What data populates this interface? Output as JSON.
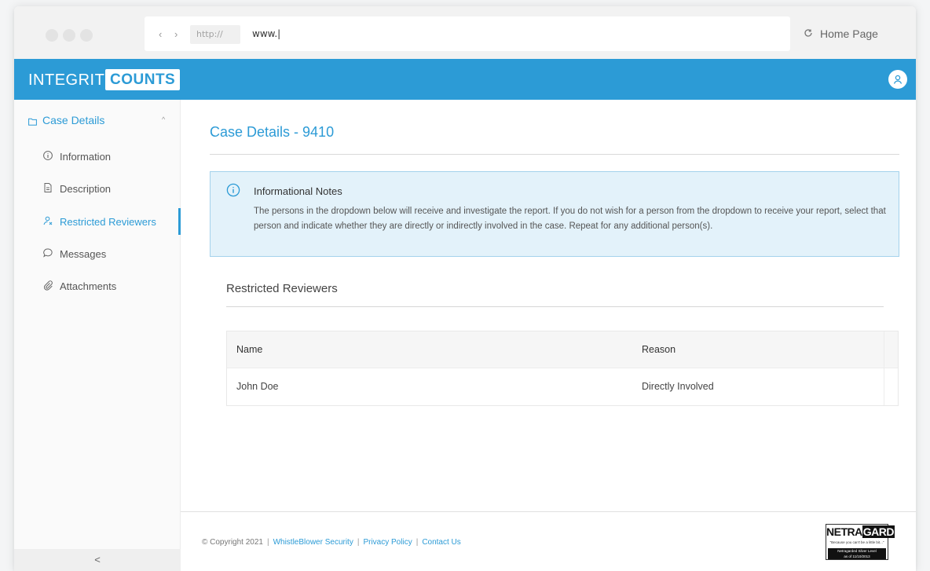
{
  "browser": {
    "nav_arrows": "‹ ›",
    "protocol": "http://",
    "url": "www.|",
    "home_label": "Home Page"
  },
  "brand": {
    "name_light": "INTEGRITY",
    "name_bold": "COUNTS",
    "color": "#2c9bd6"
  },
  "sidebar": {
    "section_label": "Case Details",
    "items": [
      {
        "label": "Information",
        "icon": "info-circle-icon"
      },
      {
        "label": "Description",
        "icon": "document-icon"
      },
      {
        "label": "Restricted Reviewers",
        "icon": "restricted-user-icon",
        "active": true
      },
      {
        "label": "Messages",
        "icon": "chat-bubble-icon"
      },
      {
        "label": "Attachments",
        "icon": "paperclip-icon"
      }
    ],
    "collapse_glyph": "<"
  },
  "main": {
    "title": "Case Details - 9410",
    "info": {
      "title": "Informational Notes",
      "text": "The persons in the dropdown below will receive and investigate the report. If you do not wish for a person from the dropdown to receive your report, select that person and indicate whether they are directly or indirectly involved in the case. Repeat for any additional person(s)."
    },
    "section_title": "Restricted Reviewers",
    "table": {
      "columns": [
        "Name",
        "Reason"
      ],
      "rows": [
        [
          "John Doe",
          "Directly Involved"
        ]
      ]
    }
  },
  "footer": {
    "copyright": "© Copyright 2021",
    "links": [
      "WhistleBlower Security",
      "Privacy Policy",
      "Contact Us"
    ],
    "badge_logo_a": "NETRA",
    "badge_logo_b": "GARD",
    "badge_tagline": "\"Because you can't be a little bit...\"",
    "badge_level": "Netragarded Silver Level",
    "badge_date": "as of 11/10/2013"
  }
}
